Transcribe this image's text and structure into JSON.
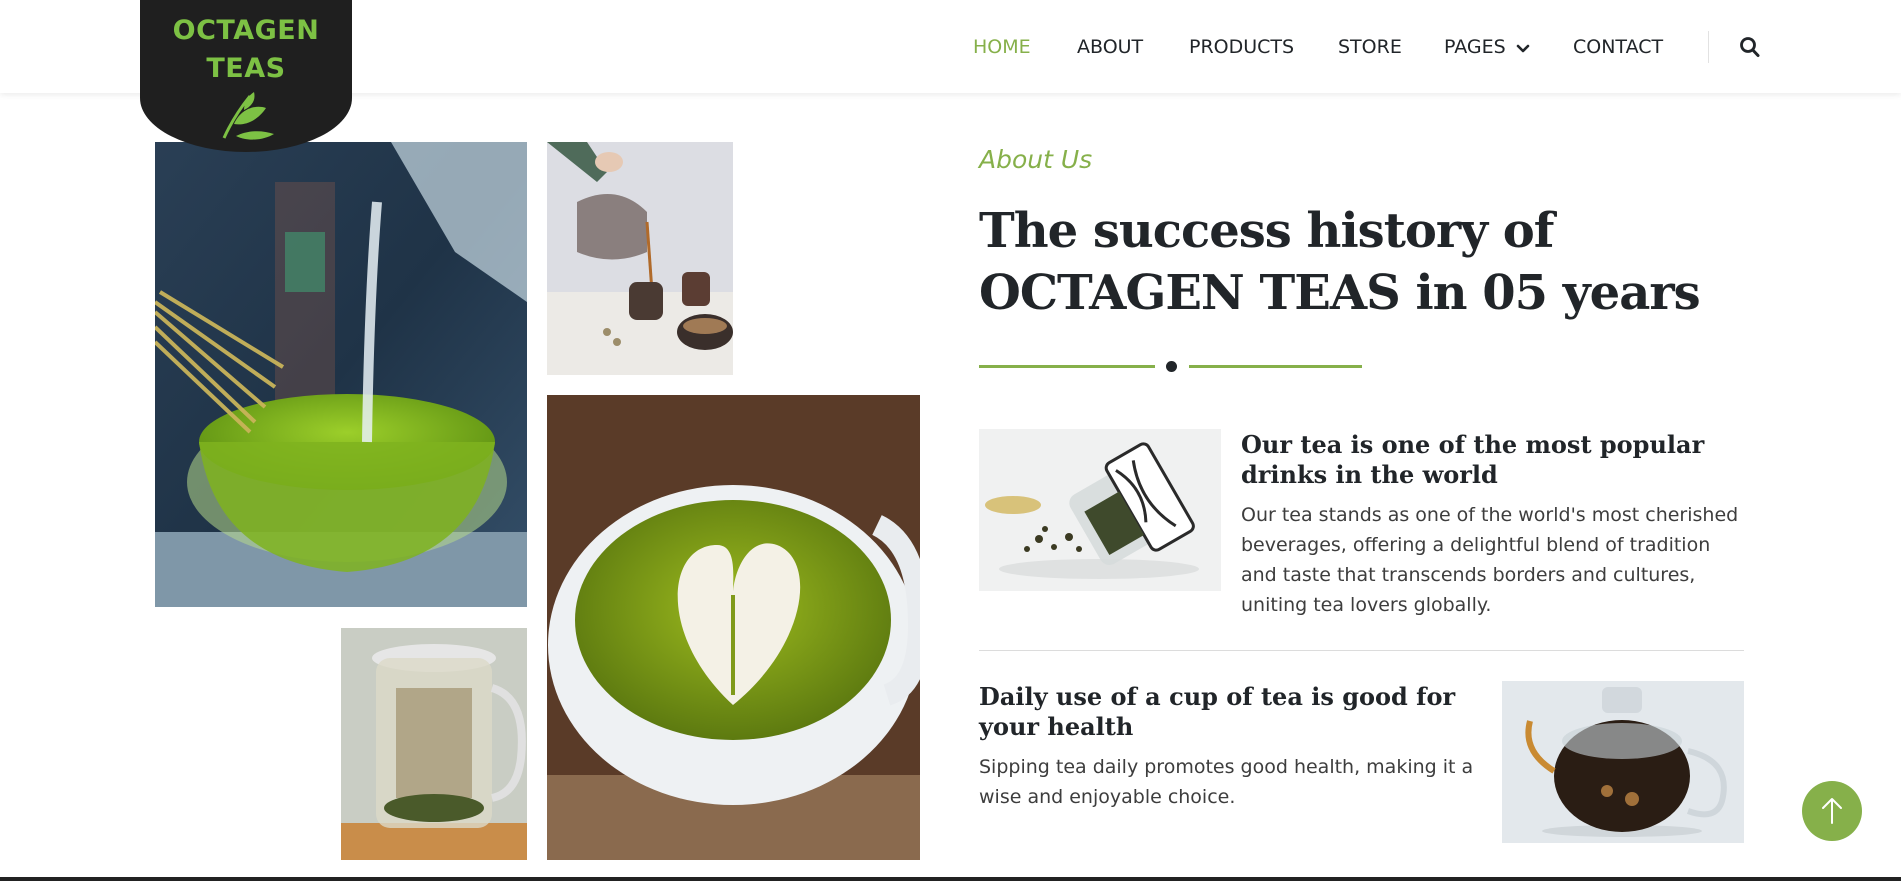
{
  "brand": {
    "logo_line1": "OCTAGEN",
    "logo_line2": "TEAS",
    "color_green": "#7dc144",
    "color_dark": "#1f1f1f"
  },
  "nav": {
    "items": [
      {
        "label": "HOME",
        "active": true
      },
      {
        "label": "ABOUT",
        "active": false
      },
      {
        "label": "PRODUCTS",
        "active": false
      },
      {
        "label": "STORE",
        "active": false
      },
      {
        "label": "PAGES",
        "active": false,
        "has_dropdown": true
      },
      {
        "label": "CONTACT",
        "active": false
      }
    ],
    "search_icon": "search-icon",
    "accent_color": "#86b04a"
  },
  "about": {
    "eyebrow": "About Us",
    "heading_line1": "The success history of",
    "heading_line2": "OCTAGEN TEAS in 05 years"
  },
  "features": [
    {
      "title": "Our tea is one of the most popular drinks in the world",
      "text": "Our tea stands as one of the world's most cherished beverages, offering a delightful blend of tradition and taste that transcends borders and cultures, uniting tea lovers globally."
    },
    {
      "title": "Daily use of a cup of tea is good for your health",
      "text": "Sipping tea daily promotes good health, making it a wise and enjoyable choice."
    }
  ],
  "scroll_top_icon": "arrow-up-icon"
}
